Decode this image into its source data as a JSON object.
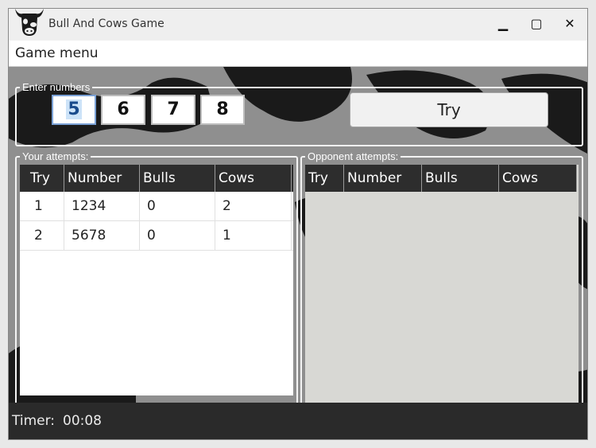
{
  "window": {
    "title": "Bull And Cows Game",
    "minimize_glyph": "▁",
    "maximize_glyph": "▢",
    "close_glyph": "✕"
  },
  "menu": {
    "game_menu": "Game menu"
  },
  "enter_numbers": {
    "legend": "Enter numbers",
    "digits": [
      "5",
      "6",
      "7",
      "8"
    ],
    "try_label": "Try"
  },
  "your_attempts": {
    "legend": "Your attempts:",
    "columns": [
      "Try",
      "Number",
      "Bulls",
      "Cows"
    ],
    "rows": [
      [
        "1",
        "1234",
        "0",
        "2"
      ],
      [
        "2",
        "5678",
        "0",
        "1"
      ]
    ]
  },
  "opponent_attempts": {
    "legend": "Opponent attempts:",
    "columns": [
      "Try",
      "Number",
      "Bulls",
      "Cows"
    ],
    "rows": []
  },
  "status": {
    "timer_label": "Timer:",
    "timer_value": "00:08"
  },
  "colors": {
    "header_bg": "#2d2d2d",
    "panel_border": "#f4f4f4",
    "focus_highlight": "#cde3f8",
    "cow_pattern": "#1a1a1a"
  },
  "icons": {
    "app": "cow-head-icon"
  }
}
